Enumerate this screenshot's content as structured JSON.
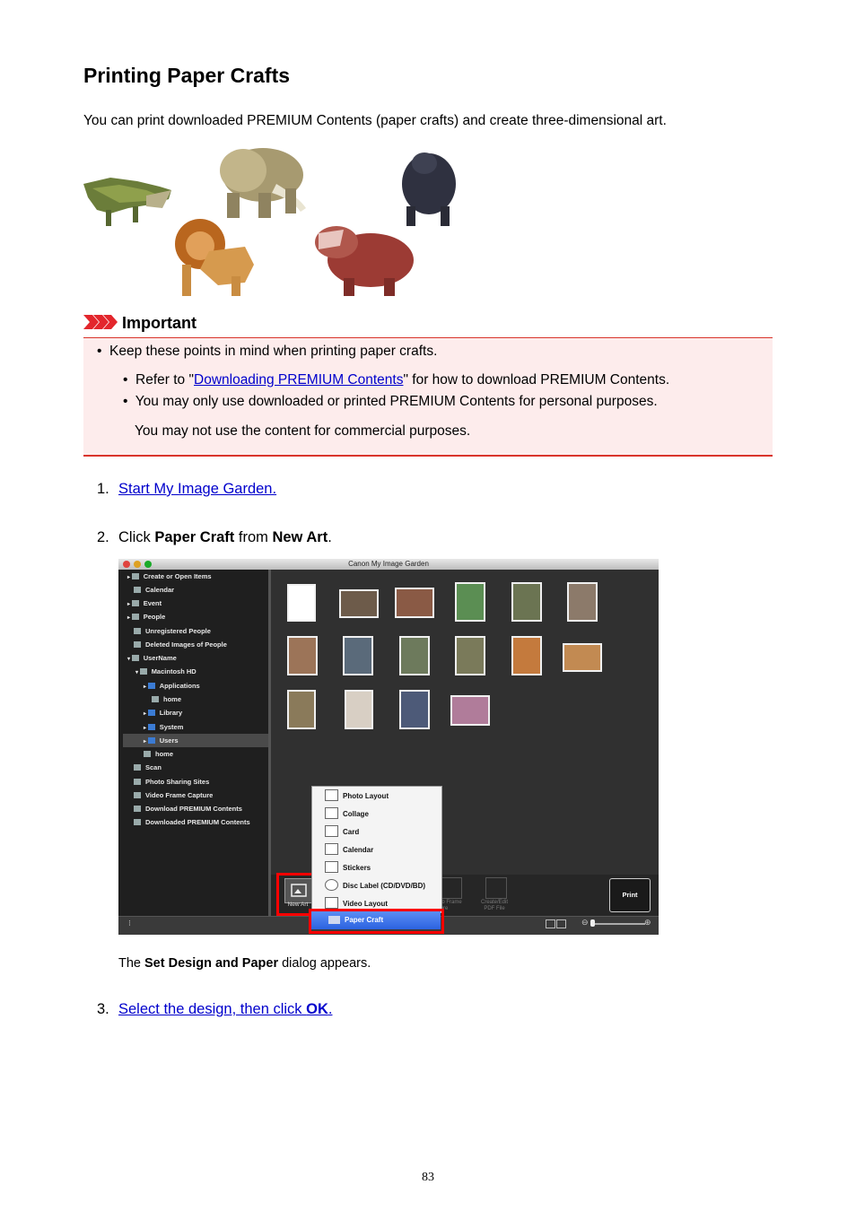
{
  "title": "Printing Paper Crafts",
  "intro": "You can print downloaded PREMIUM Contents (paper crafts) and create three-dimensional art.",
  "important": {
    "heading": "Important",
    "bullet": "Keep these points in mind when printing paper crafts.",
    "sub1_prefix": "Refer to \"",
    "sub1_link": "Downloading PREMIUM Contents",
    "sub1_suffix": "\" for how to download PREMIUM Contents.",
    "sub2": "You may only use downloaded or printed PREMIUM Contents for personal purposes.",
    "sub2_cont": "You may not use the content for commercial purposes."
  },
  "steps": {
    "s1_num": "1.",
    "s1_link": "Start My Image Garden.",
    "s2_num": "2.",
    "s2_a": "Click ",
    "s2_b": "Paper Craft",
    "s2_c": " from ",
    "s2_d": "New Art",
    "s2_e": ".",
    "s2_note_a": "The ",
    "s2_note_b": "Set Design and Paper",
    "s2_note_c": " dialog appears.",
    "s3_num": "3.",
    "s3_link_a": "Select the design, then click ",
    "s3_link_b": "OK",
    "s3_link_c": "."
  },
  "screenshot": {
    "window_title": "Canon My Image Garden",
    "sidebar": [
      "Create or Open Items",
      "Calendar",
      "Event",
      "People",
      "Unregistered People",
      "Deleted Images of People",
      "UserName",
      "Macintosh HD",
      "Applications",
      "home",
      "Library",
      "System",
      "Users",
      "home",
      "Scan",
      "Photo Sharing Sites",
      "Video Frame Capture",
      "Download PREMIUM Contents",
      "Downloaded PREMIUM Contents"
    ],
    "menu": [
      "Photo Layout",
      "Collage",
      "Card",
      "Calendar",
      "Stickers",
      "Disc Label (CD/DVD/BD)",
      "Video Layout"
    ],
    "menu_selected": "Paper Craft",
    "new_art": "New Art",
    "frame_label": "eo Frame\nture",
    "pdf_label": "Create/Edit\nPDF File",
    "print": "Print"
  },
  "page_number": "83",
  "colors": {
    "link": "#0000cc",
    "important_bg": "#fdecec",
    "important_rule": "#d9342b",
    "highlight": "#ff0000"
  }
}
